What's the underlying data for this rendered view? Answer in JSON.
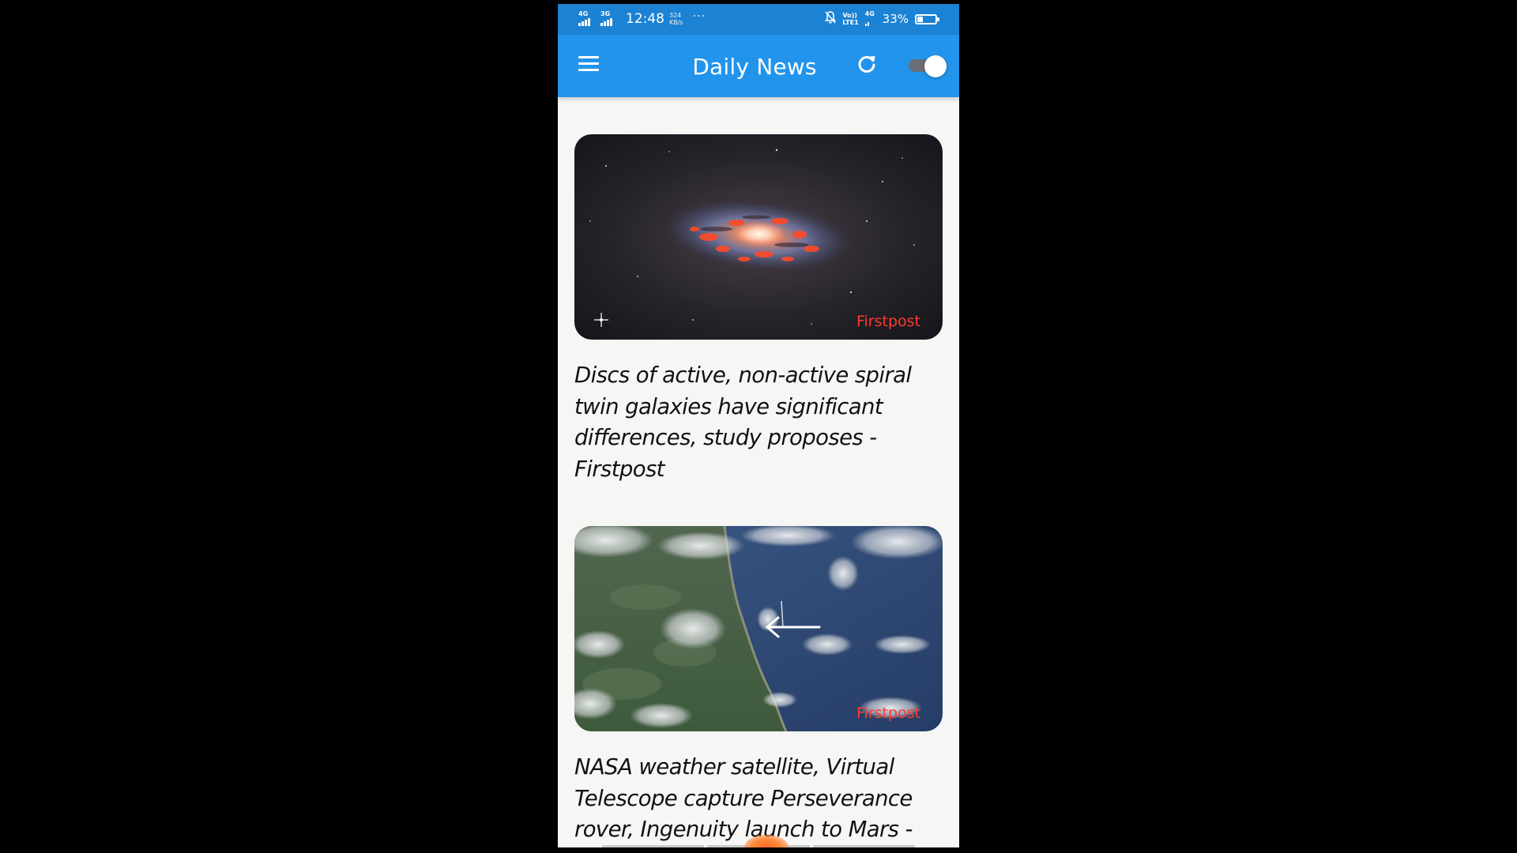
{
  "status_bar": {
    "net1": "4G",
    "net2": "3G",
    "time": "12:48",
    "speed_value": "324",
    "speed_unit": "KB/s",
    "more": "···",
    "volte_top": "Vo))",
    "volte_bottom": "LTE1",
    "net3": "4G",
    "battery_pct": "33%"
  },
  "app_bar": {
    "title": "Daily News"
  },
  "articles": [
    {
      "source": "Firstpost",
      "title": "Discs of active, non-active spiral twin galaxies have significant differences, study proposes - Firstpost"
    },
    {
      "source": "Firstpost",
      "title": "NASA weather satellite, Virtual Telescope capture Perseverance rover, Ingenuity launch to Mars -"
    }
  ],
  "colors": {
    "status_bar": "#1b82d4",
    "app_bar": "#2294ec",
    "source": "#ff3b2f",
    "toggle_track": "#6b6e73"
  },
  "icons": {
    "menu": "hamburger-icon",
    "refresh": "refresh-icon",
    "theme_toggle": "toggle-switch"
  }
}
